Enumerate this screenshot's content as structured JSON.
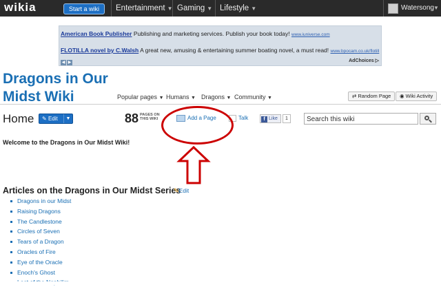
{
  "topbar": {
    "logo": "wikia",
    "start_wiki": "Start a wiki",
    "nav": [
      "Entertainment",
      "Gaming",
      "Lifestyle"
    ],
    "username": "Watersong"
  },
  "ad": {
    "line1_link": "American Book Publisher",
    "line1_text": "Publishing and marketing services. Publish your book today!",
    "line1_url": "www.iuniverse.com",
    "line2_link": "FLOTILLA novel by C.Walsh",
    "line2_text": "A great new, amusing & entertaining summer boating novel, a must read!",
    "line2_url": "www.bpocam.co.uk/flotill",
    "adchoices": "AdChoices"
  },
  "wiki": {
    "name_line1": "Dragons in Our",
    "name_line2": "Midst Wiki",
    "nav": [
      "Popular pages",
      "Humans",
      "Dragons",
      "Community"
    ],
    "random_page": "Random Page",
    "wiki_activity": "Wiki Activity"
  },
  "page": {
    "title": "Home",
    "edit": "Edit",
    "page_count": "88",
    "page_count_label_1": "PAGES ON",
    "page_count_label_2": "THIS WIKI",
    "add_page": "Add a Page",
    "talk": "Talk",
    "like": "Like",
    "like_count": "1",
    "search_placeholder": "Search this wiki"
  },
  "content": {
    "welcome": "Welcome to the Dragons in Our Midst Wiki!",
    "section_title": "Articles on the Dragons in Our Midst Series",
    "section_edit": "Edit",
    "articles": [
      "Dragons in our Midst",
      "Raising Dragons",
      "The Candlestone",
      "Circles of Seven",
      "Tears of a Dragon",
      "Oracles of Fire",
      "Eye of the Oracle",
      "Enoch's Ghost",
      "Last of the Nephilim"
    ]
  },
  "colors": {
    "topbar": "#2a2a2a",
    "accent": "#1a6fb4",
    "annotation": "#cc0000"
  }
}
